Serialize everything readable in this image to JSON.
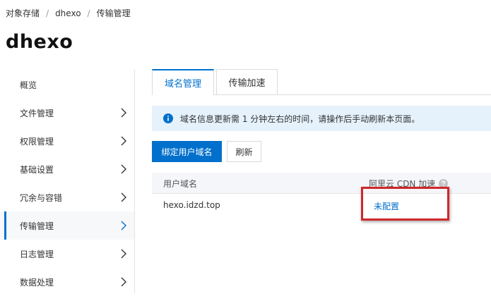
{
  "breadcrumb": {
    "items": [
      "对象存储",
      "dhexo",
      "传输管理"
    ],
    "separator": "/"
  },
  "page": {
    "title": "dhexo"
  },
  "sidebar": {
    "items": [
      {
        "label": "概览",
        "has_chevron": false
      },
      {
        "label": "文件管理",
        "has_chevron": true
      },
      {
        "label": "权限管理",
        "has_chevron": true
      },
      {
        "label": "基础设置",
        "has_chevron": true
      },
      {
        "label": "冗余与容错",
        "has_chevron": true
      },
      {
        "label": "传输管理",
        "has_chevron": true,
        "active": true
      },
      {
        "label": "日志管理",
        "has_chevron": true
      },
      {
        "label": "数据处理",
        "has_chevron": true
      }
    ]
  },
  "tabs": [
    {
      "label": "域名管理",
      "active": true
    },
    {
      "label": "传输加速",
      "active": false
    }
  ],
  "notice": {
    "icon": "info-icon",
    "text": "域名信息更新需 1 分钟左右的时间，请操作后手动刷新本页面。"
  },
  "toolbar": {
    "bind_domain_label": "绑定用户域名",
    "refresh_label": "刷新"
  },
  "table": {
    "columns": [
      "用户域名",
      "阿里云 CDN 加速"
    ],
    "rows": [
      {
        "domain": "hexo.idzd.top",
        "cdn_status": "未配置"
      }
    ]
  },
  "colors": {
    "accent": "#0070cc",
    "notice_bg": "#e5f2fc",
    "highlight": "#d0272a"
  }
}
